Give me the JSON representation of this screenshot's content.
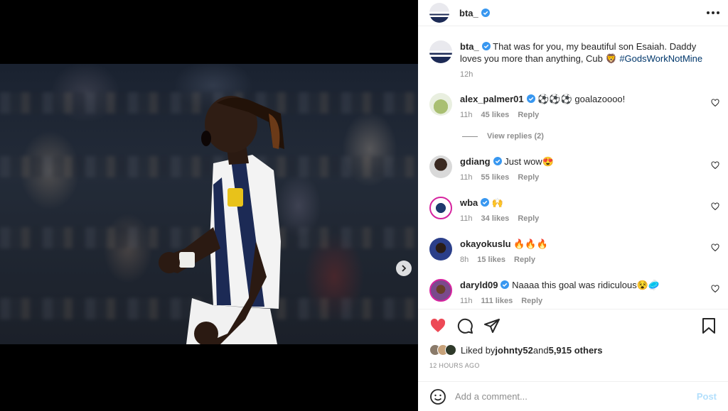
{
  "post": {
    "author": "bta_",
    "caption_text": "That was for you, my beautiful son Esaiah. Daddy loves you more than anything, Cub 🦁 ",
    "caption_hashtag": "#GodsWorkNotMine",
    "caption_time": "12h"
  },
  "comments": [
    {
      "user": "alex_palmer01",
      "text": "⚽⚽⚽ goalazoooo!",
      "time": "11h",
      "likes": "45 likes",
      "reply": "Reply",
      "avatar_color": "#9bb06a"
    },
    {
      "user": "gdiang",
      "text": "Just wow😍",
      "time": "11h",
      "likes": "55 likes",
      "reply": "Reply",
      "avatar_color": "#3a3a3a"
    },
    {
      "user": "wba",
      "text": "🙌",
      "time": "11h",
      "likes": "34 likes",
      "reply": "Reply",
      "avatar_color": "#1f3a6e"
    },
    {
      "user": "okayokuslu",
      "text": "🔥🔥🔥",
      "time": "8h",
      "likes": "15 likes",
      "reply": "Reply",
      "avatar_color": "#2b3f8a"
    },
    {
      "user": "daryld09",
      "text": "Naaaa this goal was ridiculous😵🥏",
      "time": "11h",
      "likes": "111 likes",
      "reply": "Reply",
      "avatar_color": "#6b3f7a"
    }
  ],
  "view_replies": "View replies (2)",
  "likes": {
    "prefix": "Liked by ",
    "user": "johnty52",
    "middle": " and ",
    "others": "5,915 others"
  },
  "timestamp": "12 HOURS AGO",
  "add_comment": {
    "placeholder": "Add a comment...",
    "post_label": "Post"
  },
  "icons": {
    "like": "heart-filled-icon",
    "comment": "comment-icon",
    "share": "share-icon",
    "save": "bookmark-icon",
    "emoji": "emoji-icon",
    "more": "more-options-icon",
    "next": "chevron-right-icon"
  },
  "colors": {
    "like_red": "#ed4956",
    "verified_blue": "#3897f0",
    "post_disabled": "#b2dffc"
  }
}
